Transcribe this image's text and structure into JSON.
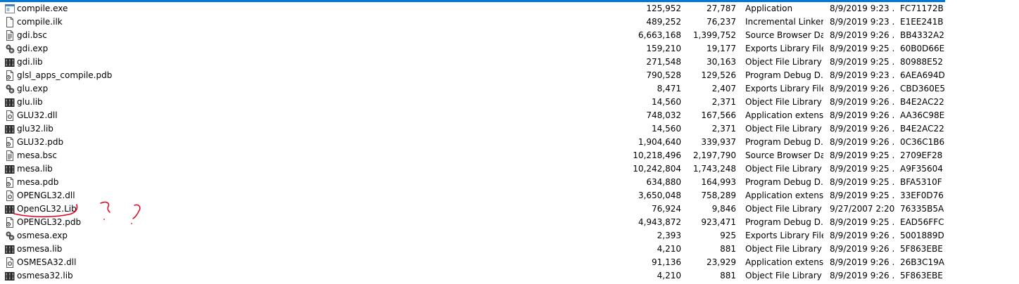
{
  "files": [
    {
      "icon": "exe-file-icon",
      "name": "compile.exe",
      "size": "125,952",
      "packed": "27,787",
      "type": "Application",
      "modified": "8/9/2019 9:23 ...",
      "crc": "FC71172B"
    },
    {
      "icon": "ilk-file-icon",
      "name": "compile.ilk",
      "size": "489,252",
      "packed": "76,237",
      "type": "Incremental Linker...",
      "modified": "8/9/2019 9:23 ...",
      "crc": "E1EE241B"
    },
    {
      "icon": "bsc-file-icon",
      "name": "gdi.bsc",
      "size": "6,663,168",
      "packed": "1,399,752",
      "type": "Source Browser Da...",
      "modified": "8/9/2019 9:26 ...",
      "crc": "BB4332A2"
    },
    {
      "icon": "exp-file-icon",
      "name": "gdi.exp",
      "size": "159,210",
      "packed": "19,177",
      "type": "Exports Library File",
      "modified": "8/9/2019 9:25 ...",
      "crc": "60B0D66E"
    },
    {
      "icon": "lib-file-icon",
      "name": "gdi.lib",
      "size": "271,548",
      "packed": "30,163",
      "type": "Object File Library",
      "modified": "8/9/2019 9:25 ...",
      "crc": "80988E52"
    },
    {
      "icon": "pdb-file-icon",
      "name": "glsl_apps_compile.pdb",
      "size": "790,528",
      "packed": "129,526",
      "type": "Program Debug D...",
      "modified": "8/9/2019 9:23 ...",
      "crc": "6AEA694D"
    },
    {
      "icon": "exp-file-icon",
      "name": "glu.exp",
      "size": "8,471",
      "packed": "2,407",
      "type": "Exports Library File",
      "modified": "8/9/2019 9:26 ...",
      "crc": "CBD360E5"
    },
    {
      "icon": "lib-file-icon",
      "name": "glu.lib",
      "size": "14,560",
      "packed": "2,371",
      "type": "Object File Library",
      "modified": "8/9/2019 9:26 ...",
      "crc": "B4E2AC22"
    },
    {
      "icon": "dll-file-icon",
      "name": "GLU32.dll",
      "size": "748,032",
      "packed": "167,566",
      "type": "Application extens...",
      "modified": "8/9/2019 9:26 ...",
      "crc": "AA36C98E"
    },
    {
      "icon": "lib-file-icon",
      "name": "glu32.lib",
      "size": "14,560",
      "packed": "2,371",
      "type": "Object File Library",
      "modified": "8/9/2019 9:26 ...",
      "crc": "B4E2AC22"
    },
    {
      "icon": "pdb-file-icon",
      "name": "GLU32.pdb",
      "size": "1,904,640",
      "packed": "339,937",
      "type": "Program Debug D...",
      "modified": "8/9/2019 9:26 ...",
      "crc": "0C36C1B6"
    },
    {
      "icon": "bsc-file-icon",
      "name": "mesa.bsc",
      "size": "10,218,496",
      "packed": "2,197,790",
      "type": "Source Browser Da...",
      "modified": "8/9/2019 9:25 ...",
      "crc": "2709EF28"
    },
    {
      "icon": "lib-file-icon",
      "name": "mesa.lib",
      "size": "10,242,804",
      "packed": "1,743,248",
      "type": "Object File Library",
      "modified": "8/9/2019 9:25 ...",
      "crc": "A9F35604"
    },
    {
      "icon": "pdb-file-icon",
      "name": "mesa.pdb",
      "size": "634,880",
      "packed": "164,993",
      "type": "Program Debug D...",
      "modified": "8/9/2019 9:25 ...",
      "crc": "BFA5310F"
    },
    {
      "icon": "dll-file-icon",
      "name": "OPENGL32.dll",
      "size": "3,650,048",
      "packed": "758,289",
      "type": "Application extens...",
      "modified": "8/9/2019 9:25 ...",
      "crc": "33EF0D76"
    },
    {
      "icon": "lib-file-icon",
      "name": "OpenGL32.Lib",
      "size": "76,924",
      "packed": "9,846",
      "type": "Object File Library",
      "modified": "9/27/2007 2:20 ...",
      "crc": "76335B5A"
    },
    {
      "icon": "pdb-file-icon",
      "name": "OPENGL32.pdb",
      "size": "4,943,872",
      "packed": "923,471",
      "type": "Program Debug D...",
      "modified": "8/9/2019 9:25 ...",
      "crc": "EAD56FFC"
    },
    {
      "icon": "exp-file-icon",
      "name": "osmesa.exp",
      "size": "2,393",
      "packed": "925",
      "type": "Exports Library File",
      "modified": "8/9/2019 9:26 ...",
      "crc": "5001889D"
    },
    {
      "icon": "lib-file-icon",
      "name": "osmesa.lib",
      "size": "4,210",
      "packed": "881",
      "type": "Object File Library",
      "modified": "8/9/2019 9:26 ...",
      "crc": "5F863EBE"
    },
    {
      "icon": "dll-file-icon",
      "name": "OSMESA32.dll",
      "size": "91,136",
      "packed": "23,929",
      "type": "Application extens...",
      "modified": "8/9/2019 9:26 ...",
      "crc": "26B3C19A"
    },
    {
      "icon": "lib-file-icon",
      "name": "osmesa32.lib",
      "size": "4,210",
      "packed": "881",
      "type": "Object File Library",
      "modified": "8/9/2019 9:26 ...",
      "crc": "5F863EBE"
    }
  ],
  "colors": {
    "selection_bar": "#0078d7",
    "annotation_ink": "#e8001c"
  }
}
